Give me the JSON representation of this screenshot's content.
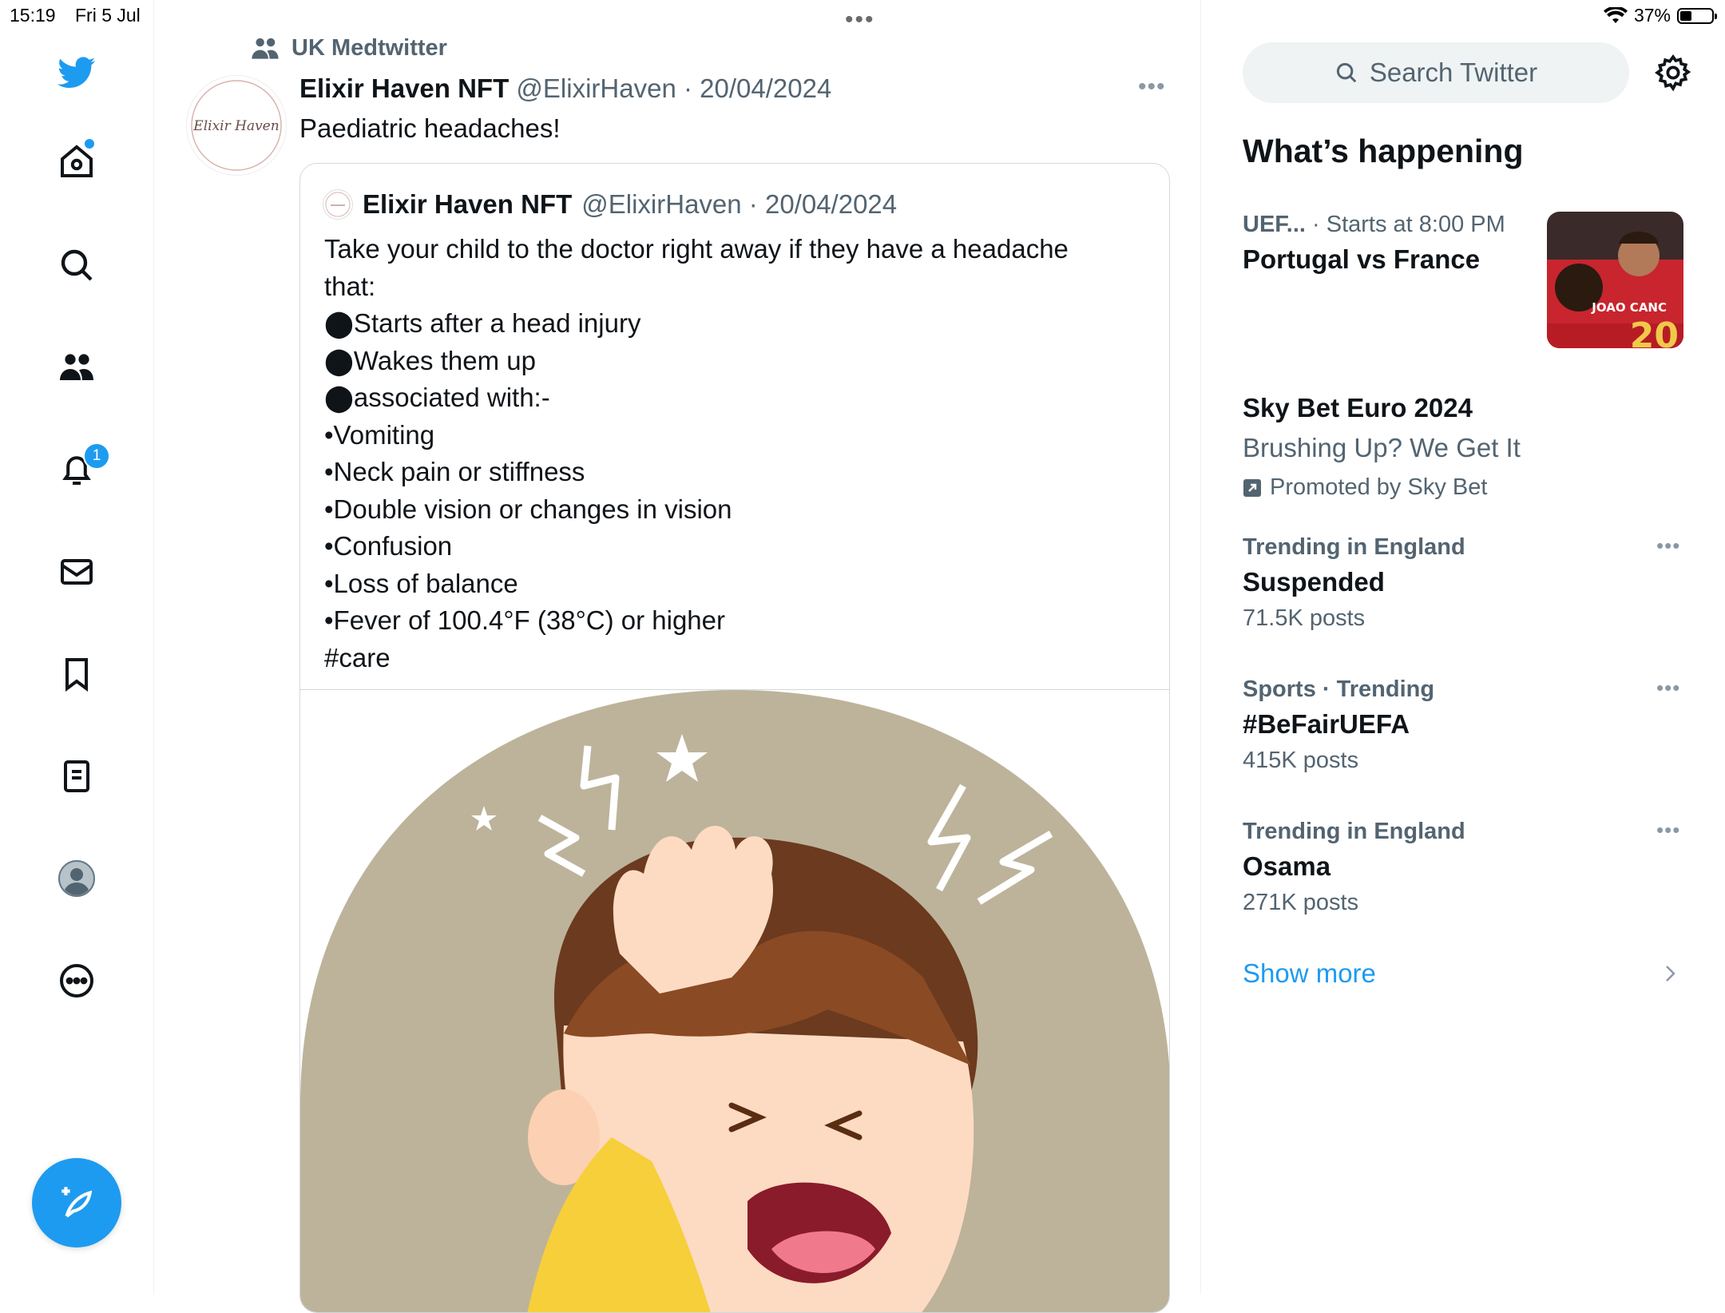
{
  "status_bar": {
    "time": "15:19",
    "date": "Fri 5 Jul",
    "battery": "37%",
    "battery_level": 0.37
  },
  "nav": {
    "items": [
      "twitter-logo",
      "home",
      "explore",
      "communities",
      "notifications",
      "messages",
      "bookmarks",
      "lists",
      "profile",
      "more"
    ],
    "notification_count": "1",
    "accent": "#1d9bf0"
  },
  "tweet": {
    "context": "UK Medtwitter",
    "author_name": "Elixir Haven NFT",
    "author_meta": "@ElixirHaven · 20/04/2024",
    "avatar_text": "Elixir Haven",
    "text": "Paediatric headaches!",
    "quote": {
      "author_name": "Elixir Haven NFT",
      "author_meta": "@ElixirHaven · 20/04/2024",
      "lines": [
        "Take your child to the doctor right away if they have a headache",
        "that:",
        "⬤Starts after a head injury",
        "⬤Wakes them up",
        "⬤associated with:-",
        "•Vomiting",
        "•Neck pain or stiffness",
        "•Double vision or changes in vision",
        "•Confusion",
        "•Loss of balance",
        "•Fever of 100.4°F (38°C) or higher",
        "#care"
      ]
    }
  },
  "sidebar": {
    "search_placeholder": "Search Twitter",
    "heading": "What’s happening",
    "event": {
      "category": "UEF...",
      "time": "· Starts at 8:00 PM",
      "title": "Portugal vs France",
      "thumb_text": "JOAO CANC"
    },
    "promoted": {
      "title": "Sky Bet Euro 2024",
      "subtitle": "Brushing Up? We Get It",
      "by": "Promoted by Sky Bet"
    },
    "trends": [
      {
        "context": "Trending in England",
        "name": "Suspended",
        "count": "71.5K posts"
      },
      {
        "context": "Sports · Trending",
        "name": "#BeFairUEFA",
        "count": "415K posts"
      },
      {
        "context": "Trending in England",
        "name": "Osama",
        "count": "271K posts"
      }
    ],
    "show_more": "Show more"
  }
}
